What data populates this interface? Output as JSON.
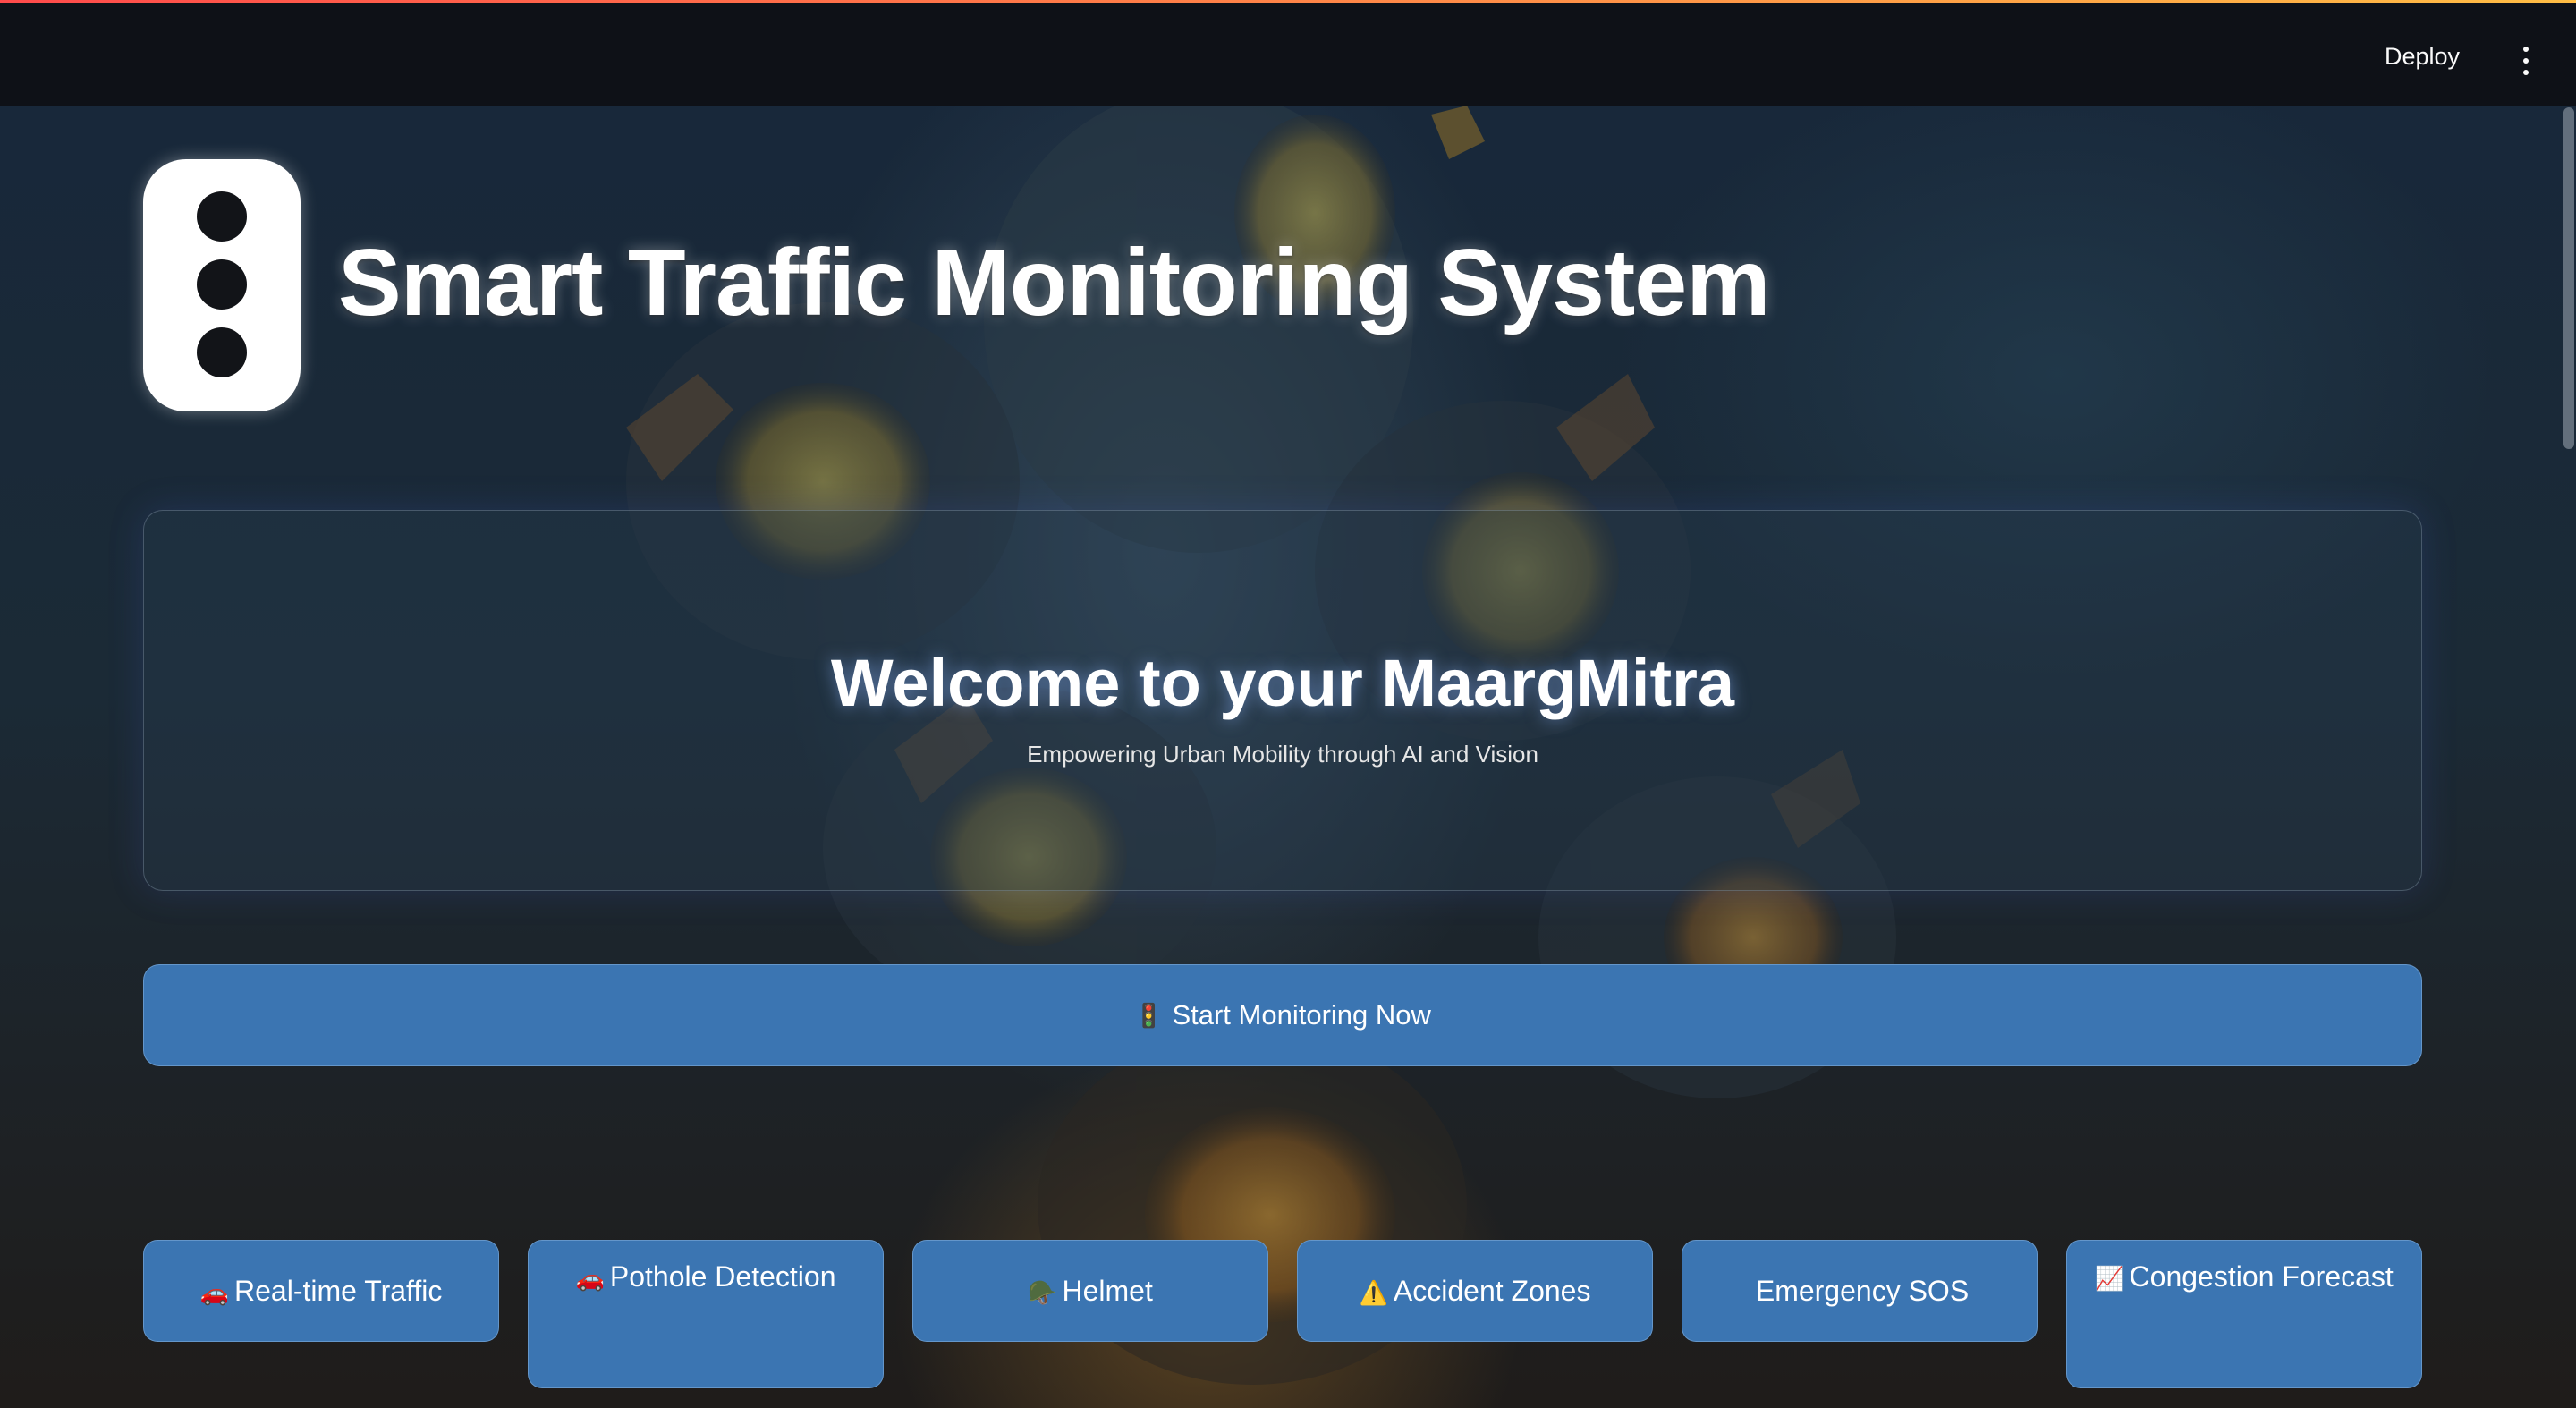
{
  "header": {
    "deploy_label": "Deploy"
  },
  "app": {
    "title": "Smart Traffic Monitoring System"
  },
  "welcome": {
    "title": "Welcome to your MaargMitra",
    "subtitle": "Empowering Urban Mobility through AI and Vision"
  },
  "start_button": {
    "emoji": "🚦",
    "label": "Start Monitoring Now"
  },
  "features": [
    {
      "emoji": "🚗",
      "label": "Real-time Traffic"
    },
    {
      "emoji": "🚗",
      "label": "Pothole Detection"
    },
    {
      "emoji": "🪖",
      "label": "Helmet"
    },
    {
      "emoji": "⚠️",
      "label": "Accident Zones"
    },
    {
      "emoji": "",
      "label": "Emergency SOS"
    },
    {
      "emoji": "📈",
      "label": "Congestion Forecast"
    }
  ],
  "colors": {
    "button_bg": "#3b75b2",
    "header_bg": "#0e1117",
    "accent_gradient_start": "#ff4b4b",
    "accent_gradient_end": "#ffbd45"
  }
}
